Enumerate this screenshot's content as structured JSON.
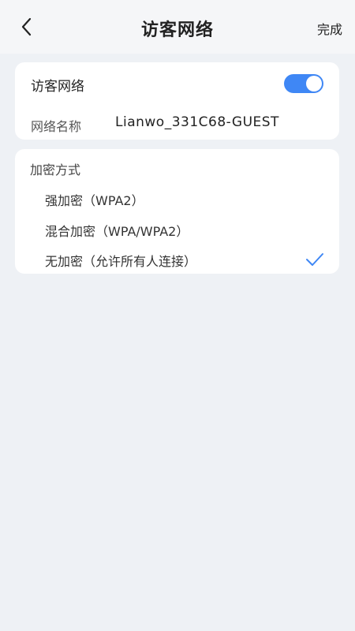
{
  "header": {
    "title": "访客网络",
    "done_label": "完成",
    "back_icon": "chevron-left-icon"
  },
  "guest_network": {
    "toggle_label": "访客网络",
    "enabled": true,
    "name_label": "网络名称",
    "name_value": "Lianwo_331C68-GUEST"
  },
  "encryption": {
    "section_label": "加密方式",
    "options": [
      {
        "label": "强加密（WPA2）",
        "selected": false
      },
      {
        "label": "混合加密（WPA/WPA2）",
        "selected": false
      },
      {
        "label": "无加密（允许所有人连接）",
        "selected": true
      }
    ]
  },
  "colors": {
    "accent": "#3f87f5",
    "background": "#eef1f5",
    "card": "#ffffff"
  }
}
